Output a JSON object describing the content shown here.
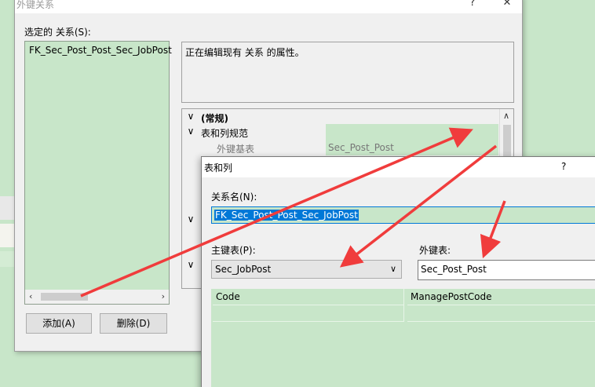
{
  "outer_dialog": {
    "title": "外键关系",
    "help_glyph": "?",
    "close_glyph": "✕",
    "selected_relation_label": "选定的 关系(S):",
    "relations": [
      "FK_Sec_Post_Post_Sec_JobPost"
    ],
    "description": "正在编辑现有 关系 的属性。",
    "add_button": "添加(A)",
    "delete_button": "删除(D)",
    "property_grid": {
      "general_label": "(常规)",
      "table_columns_label": "表和列规范",
      "foreign_base_table_label": "外键基表",
      "foreign_base_table_value": "Sec_Post_Post"
    }
  },
  "inner_dialog": {
    "title": "表和列",
    "help_glyph": "?",
    "relation_name_label": "关系名(N):",
    "relation_name_value": "FK_Sec_Post_Post_Sec_JobPost",
    "primary_table_label": "主键表(P):",
    "primary_table_value": "Sec_JobPost",
    "foreign_table_label": "外键表:",
    "foreign_table_value": "Sec_Post_Post",
    "columns": {
      "primary": [
        "Code"
      ],
      "foreign": [
        "ManagePostCode"
      ]
    }
  },
  "colors": {
    "highlight_green": "#c8e6c9",
    "dialog_gray": "#f0f0f0",
    "arrow_red": "#f03c3c",
    "selection_blue": "#0078d7"
  }
}
